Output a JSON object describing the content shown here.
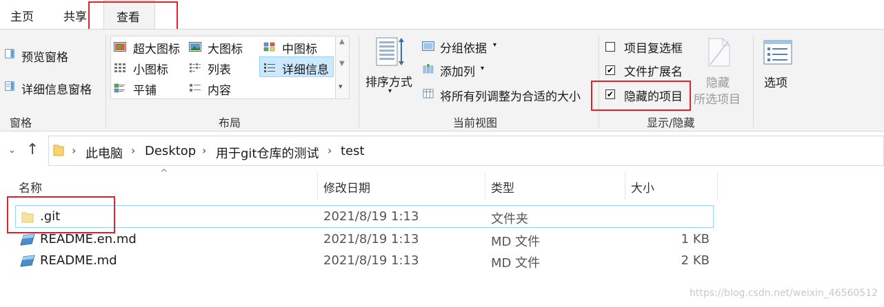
{
  "tabs": {
    "home": "主页",
    "share": "共享",
    "view": "查看"
  },
  "panes": {
    "preview": "预览窗格",
    "details": "详细信息窗格",
    "group_label": "窗格"
  },
  "layout": {
    "extra_large": "超大图标",
    "large": "大图标",
    "medium": "中图标",
    "small": "小图标",
    "list": "列表",
    "details": "详细信息",
    "tiles": "平铺",
    "content": "内容",
    "group_label": "布局"
  },
  "current_view": {
    "sort_by": "排序方式",
    "group_by": "分组依据",
    "add_columns": "添加列",
    "size_all_columns": "将所有列调整为合适的大小",
    "group_label": "当前视图"
  },
  "show_hide": {
    "item_checkboxes": "项目复选框",
    "item_checkboxes_checked": false,
    "file_extensions": "文件扩展名",
    "file_extensions_checked": true,
    "hidden_items": "隐藏的项目",
    "hidden_items_checked": true,
    "hide_selected_line1": "隐藏",
    "hide_selected_line2": "所选项目",
    "group_label": "显示/隐藏"
  },
  "options": {
    "label": "选项"
  },
  "address": {
    "segments": [
      "此电脑",
      "Desktop",
      "用于git仓库的测试",
      "test"
    ]
  },
  "columns": {
    "name": "名称",
    "modified": "修改日期",
    "type": "类型",
    "size": "大小"
  },
  "files": [
    {
      "name": ".git",
      "modified": "2021/8/19 1:13",
      "type": "文件夹",
      "size": ""
    },
    {
      "name": "README.en.md",
      "modified": "2021/8/19 1:13",
      "type": "MD 文件",
      "size": "1 KB"
    },
    {
      "name": "README.md",
      "modified": "2021/8/19 1:13",
      "type": "MD 文件",
      "size": "2 KB"
    }
  ],
  "watermark": "https://blog.csdn.net/weixin_46560512",
  "colors": {
    "highlight": "#e0202a",
    "selection": "#cce8ff",
    "selection_border": "#99d1ff",
    "folder": "#f7d46b"
  }
}
